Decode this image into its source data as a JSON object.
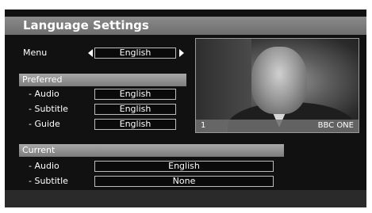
{
  "header": {
    "title": "Language Settings"
  },
  "menu": {
    "label": "Menu",
    "value": "English"
  },
  "preferred": {
    "heading": "Preferred",
    "rows": [
      {
        "label": "- Audio",
        "value": "English"
      },
      {
        "label": "- Subtitle",
        "value": "English"
      },
      {
        "label": "- Guide",
        "value": "English"
      }
    ]
  },
  "current": {
    "heading": "Current",
    "rows": [
      {
        "label": "- Audio",
        "value": "English"
      },
      {
        "label": "- Subtitle",
        "value": "None"
      }
    ]
  },
  "preview": {
    "channel_number": "1",
    "channel_name": "BBC ONE"
  }
}
